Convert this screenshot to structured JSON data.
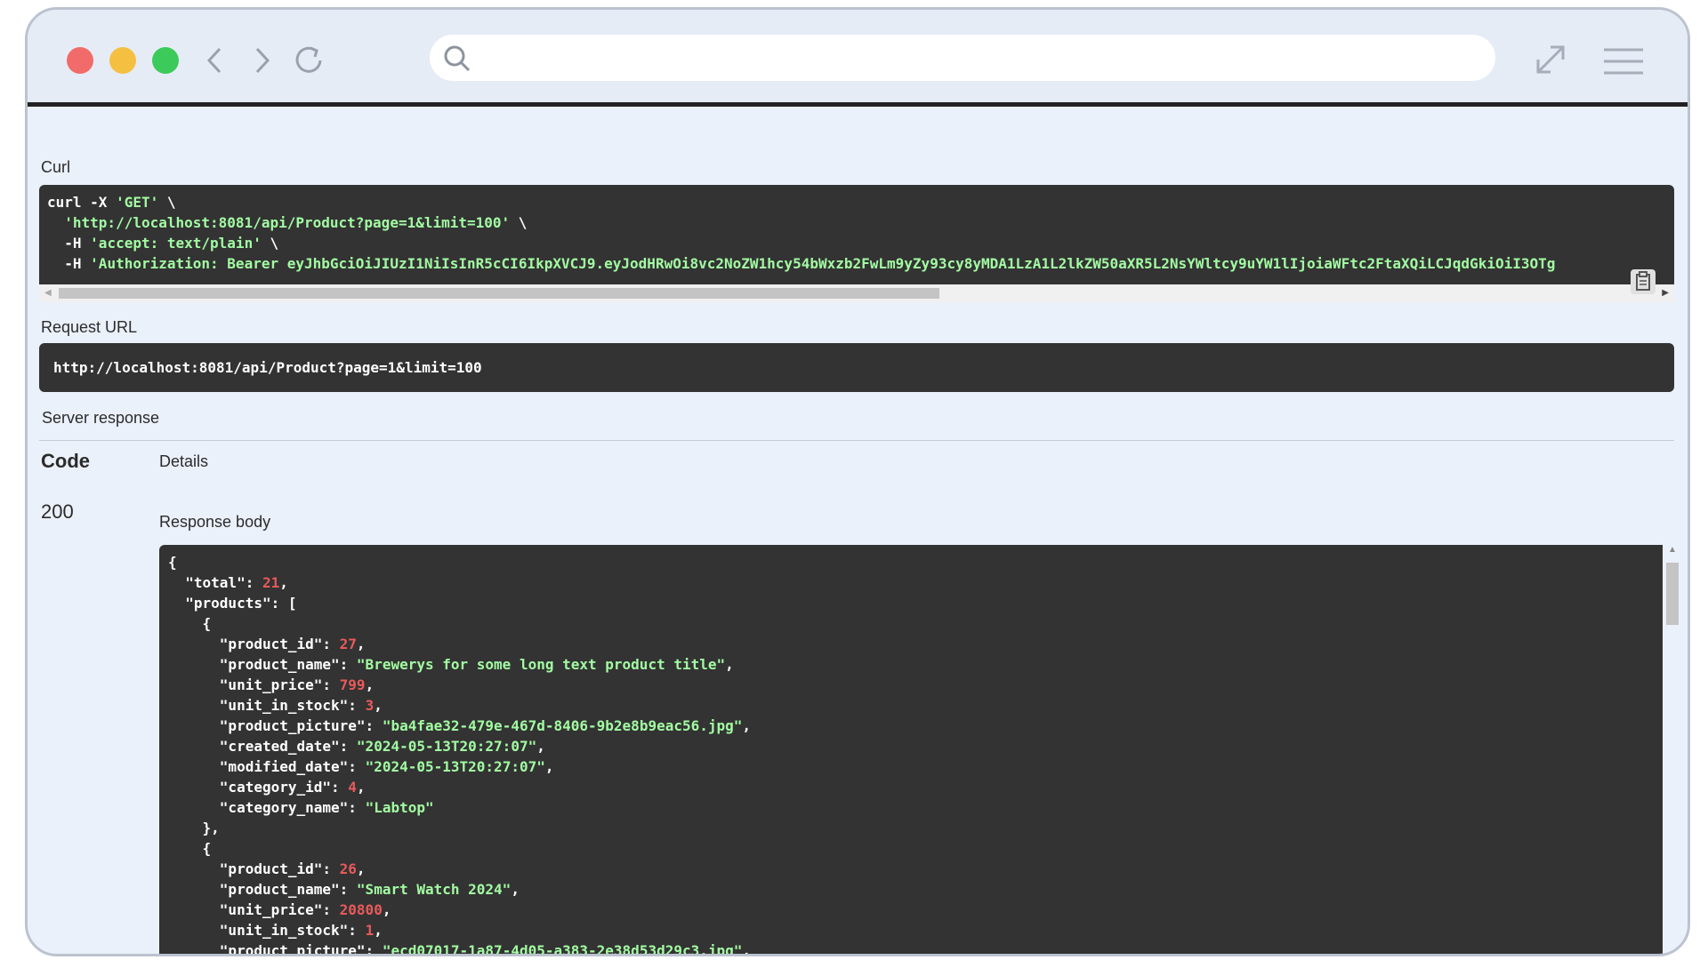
{
  "browser": {
    "address_placeholder": ""
  },
  "labels": {
    "curl": "Curl",
    "request_url": "Request URL",
    "server_response": "Server response",
    "code_header": "Code",
    "details_header": "Details",
    "status_code": "200",
    "response_body": "Response body"
  },
  "curl": {
    "line1_cmd": "curl -X ",
    "line1_method": "'GET'",
    "line1_tail": " \\",
    "line2_url": "'http://localhost:8081/api/Product?page=1&limit=100'",
    "line2_tail": " \\",
    "line3_flag": "  -H ",
    "line3_val": "'accept: text/plain'",
    "line3_tail": " \\",
    "line4_flag": "  -H ",
    "line4_val": "'Authorization: Bearer eyJhbGciOiJIUzI1NiIsInR5cCI6IkpXVCJ9.eyJodHRwOi8vc2NoZW1hcy54bWxzb2FwLm9yZy93cy8yMDA1LzA1L2lkZW50aXR5L2NsYWltcy9uYW1lIjoiaWFtc2FtaXQiLCJqdGkiOiI3OTg"
  },
  "request_url": "http://localhost:8081/api/Product?page=1&limit=100",
  "response": {
    "total": "21",
    "products": [
      {
        "product_id": "27",
        "product_name": "\"Brewerys for some long text product title\"",
        "unit_price": "799",
        "unit_in_stock": "3",
        "product_picture": "\"ba4fae32-479e-467d-8406-9b2e8b9eac56.jpg\"",
        "created_date": "\"2024-05-13T20:27:07\"",
        "modified_date": "\"2024-05-13T20:27:07\"",
        "category_id": "4",
        "category_name": "\"Labtop\""
      },
      {
        "product_id": "26",
        "product_name": "\"Smart Watch 2024\"",
        "unit_price": "20800",
        "unit_in_stock": "1",
        "product_picture": "\"ecd07017-1a87-4d05-a383-2e38d53d29c3.jpg\""
      }
    ]
  },
  "colors": {
    "code_bg": "#333333",
    "string": "#a2fca2",
    "number": "#e85a5a",
    "window_bg": "#ebf1fb"
  },
  "icons": [
    "close-light",
    "minimize-light",
    "maximize-light",
    "back-icon",
    "forward-icon",
    "reload-icon",
    "search-icon",
    "expand-icon",
    "menu-icon",
    "copy-icon"
  ]
}
